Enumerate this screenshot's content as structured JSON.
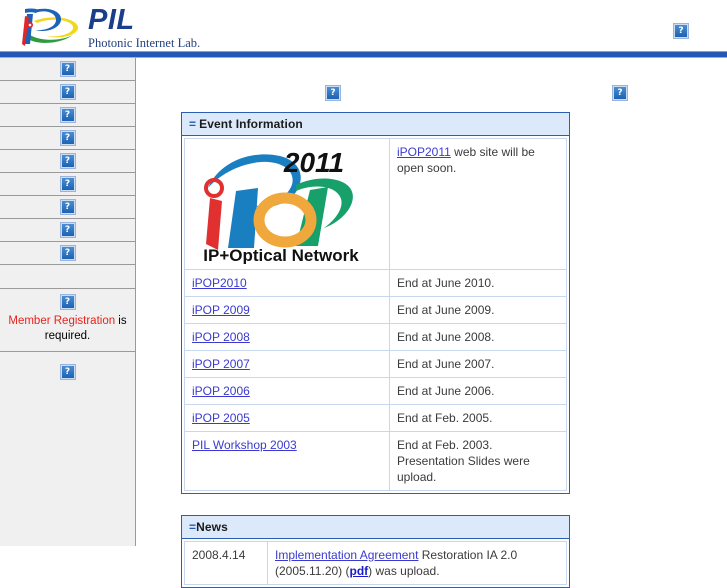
{
  "header": {
    "logo_title": "PIL",
    "logo_subtitle": "Photonic Internet Lab.",
    "broken_icon_glyph": "?"
  },
  "sidebar": {
    "items": [
      {
        "icon": "broken-image-icon"
      },
      {
        "icon": "broken-image-icon"
      },
      {
        "icon": "broken-image-icon"
      },
      {
        "icon": "broken-image-icon"
      },
      {
        "icon": "broken-image-icon"
      },
      {
        "icon": "broken-image-icon"
      },
      {
        "icon": "broken-image-icon"
      },
      {
        "icon": "broken-image-icon"
      },
      {
        "icon": "broken-image-icon"
      }
    ],
    "note": {
      "icon": "broken-image-icon",
      "link_text": "Member Registration",
      "rest_text": " is required.",
      "link_color": "#e8231c"
    },
    "bottom_icon": "broken-image-icon"
  },
  "main": {
    "top_icons": [
      {
        "name": "broken-image-icon-center"
      },
      {
        "name": "broken-image-icon-right"
      }
    ],
    "event_panel": {
      "title": "Event Information",
      "eq": "=",
      "featured": {
        "logo_alt": "iPOP 2011 IP+Optical Network",
        "logo_year": "2011",
        "logo_word": "iPOP",
        "logo_tagline": "IP+Optical Network",
        "link": "iPOP2011",
        "text": " web site will be open soon."
      },
      "rows": [
        {
          "link": "iPOP2010",
          "note": "End at June 2010."
        },
        {
          "link": "iPOP 2009",
          "note": "End at June 2009."
        },
        {
          "link": "iPOP 2008",
          "note": "End at June 2008."
        },
        {
          "link": "iPOP 2007",
          "note": "End at June 2007."
        },
        {
          "link": "iPOP 2006",
          "note": "End at June 2006."
        },
        {
          "link": "iPOP 2005",
          "note": "End at Feb. 2005."
        },
        {
          "link": "PIL Workshop 2003",
          "note": "End at Feb. 2003.",
          "note2": "Presentation Slides were upload."
        }
      ]
    },
    "news_panel": {
      "title": "News",
      "eq": "=",
      "rows": [
        {
          "date": "2008.4.14",
          "link": "Implementation Agreement",
          "text_a": " Restoration IA 2.0",
          "text_b": "(2005.11.20) (",
          "pdf": "pdf",
          "text_c": ") was upload."
        }
      ]
    }
  },
  "colors": {
    "brand_blue": "#2458b4",
    "panel_head_bg": "#dce9fa",
    "link": "#3a3ad0",
    "alert_red": "#e8231c",
    "sidebar_bg": "#f0f0f0"
  }
}
